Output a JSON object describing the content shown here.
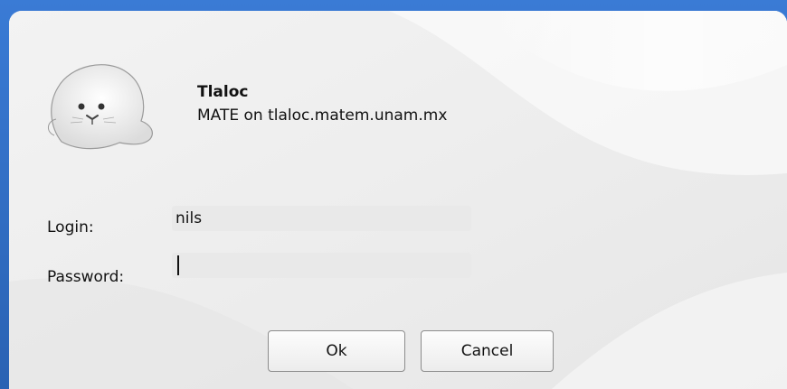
{
  "dialog": {
    "host_title": "Tlaloc",
    "session_subtitle": "MATE on tlaloc.matem.unam.mx"
  },
  "form": {
    "login_label": "Login:",
    "login_value": "nils",
    "password_label": "Password:",
    "password_value": ""
  },
  "buttons": {
    "ok_label": "Ok",
    "cancel_label": "Cancel"
  },
  "icons": {
    "avatar": "seal-avatar-icon"
  },
  "colors": {
    "desktop_blue": "#2f6fc4",
    "dialog_bg": "#ececec",
    "field_bg": "#e9e9e9"
  }
}
